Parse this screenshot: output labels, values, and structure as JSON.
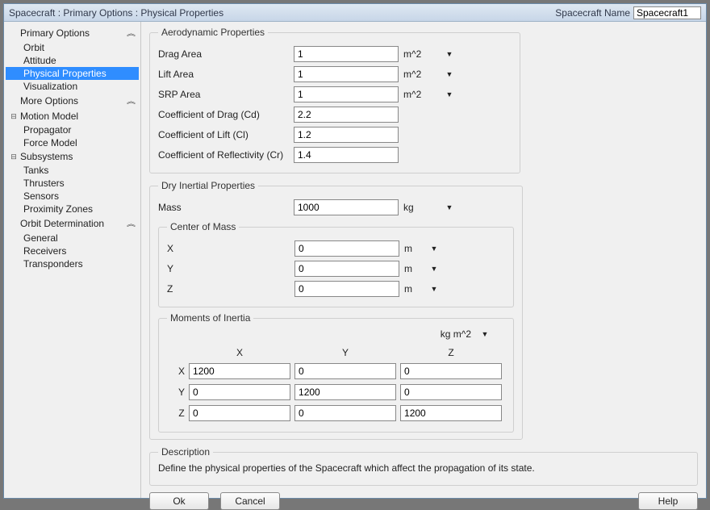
{
  "title": "Spacecraft : Primary Options : Physical Properties",
  "sc_name_label": "Spacecraft Name",
  "sc_name_value": "Spacecraft1",
  "sidebar": {
    "chevron": "︽",
    "plus": "⊞",
    "minus": "⊟",
    "sections": [
      {
        "header": "Primary Options",
        "expander": "",
        "items": [
          "Orbit",
          "Attitude",
          "Physical Properties",
          "Visualization"
        ],
        "selected_index": 2
      },
      {
        "header": "More Options",
        "expander": "",
        "items": []
      },
      {
        "header": "Motion Model",
        "expander": "minus",
        "no_chevron": true,
        "items": [
          "Propagator",
          "Force Model"
        ]
      },
      {
        "header": "Subsystems",
        "expander": "minus",
        "no_chevron": true,
        "items": [
          "Tanks",
          "Thrusters",
          "Sensors",
          "Proximity Zones"
        ]
      },
      {
        "header": "Orbit Determination",
        "expander": "",
        "items": [
          "General",
          "Receivers",
          "Transponders"
        ]
      }
    ]
  },
  "aero": {
    "legend": "Aerodynamic Properties",
    "drag_area_label": "Drag Area",
    "drag_area_value": "1",
    "drag_area_unit": "m^2",
    "lift_area_label": "Lift Area",
    "lift_area_value": "1",
    "lift_area_unit": "m^2",
    "srp_area_label": "SRP Area",
    "srp_area_value": "1",
    "srp_area_unit": "m^2",
    "cd_label": "Coefficient of Drag (Cd)",
    "cd_value": "2.2",
    "cl_label": "Coefficient of Lift (Cl)",
    "cl_value": "1.2",
    "cr_label": "Coefficient of Reflectivity (Cr)",
    "cr_value": "1.4"
  },
  "dry": {
    "legend": "Dry Inertial Properties",
    "mass_label": "Mass",
    "mass_value": "1000",
    "mass_unit": "kg",
    "com": {
      "legend": "Center of Mass",
      "x_label": "X",
      "x_value": "0",
      "x_unit": "m",
      "y_label": "Y",
      "y_value": "0",
      "y_unit": "m",
      "z_label": "Z",
      "z_value": "0",
      "z_unit": "m"
    },
    "moi": {
      "legend": "Moments of Inertia",
      "unit": "kg m^2",
      "col_x": "X",
      "col_y": "Y",
      "col_z": "Z",
      "row_x": "X",
      "row_y": "Y",
      "row_z": "Z",
      "xx": "1200",
      "xy": "0",
      "xz": "0",
      "yx": "0",
      "yy": "1200",
      "yz": "0",
      "zx": "0",
      "zy": "0",
      "zz": "1200"
    }
  },
  "description": {
    "legend": "Description",
    "text": "Define the physical properties of the Spacecraft which affect the propagation of its state."
  },
  "buttons": {
    "ok": "Ok",
    "cancel": "Cancel",
    "help": "Help"
  }
}
